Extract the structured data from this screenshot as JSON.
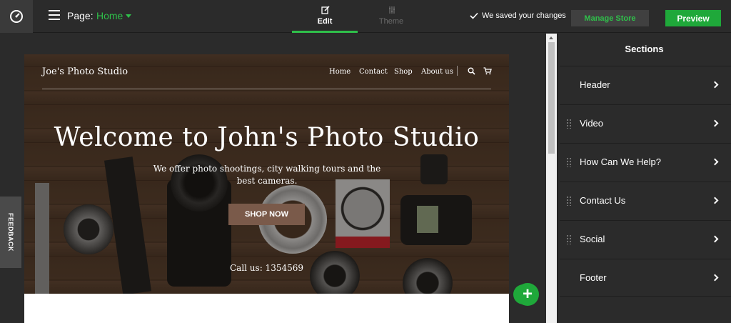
{
  "topbar": {
    "page_label": "Page:",
    "page_value": "Home",
    "tabs": [
      {
        "label": "Edit",
        "active": true
      },
      {
        "label": "Theme",
        "active": false
      }
    ],
    "saved_status": "We saved your changes",
    "manage_store_label": "Manage Store",
    "preview_label": "Preview"
  },
  "site": {
    "logo": "Joe's Photo Studio",
    "nav": [
      "Home",
      "Contact",
      "Shop",
      "About us"
    ],
    "hero_title": "Welcome to John's Photo Studio",
    "hero_subtitle": "We offer photo shootings, city walking tours and the best cameras.",
    "cta_label": "SHOP NOW",
    "call_text": "Call us: 1354569"
  },
  "feedback_label": "FEEDBACK",
  "sidebar": {
    "title": "Sections",
    "sections": [
      {
        "label": "Header",
        "draggable": false
      },
      {
        "label": "Video",
        "draggable": true
      },
      {
        "label": "How Can We Help?",
        "draggable": true
      },
      {
        "label": "Contact Us",
        "draggable": true
      },
      {
        "label": "Social",
        "draggable": true
      },
      {
        "label": "Footer",
        "draggable": false
      }
    ]
  },
  "colors": {
    "accent": "#2fbf4a",
    "preview": "#1fa83a",
    "bar_bg": "#2b2b2b",
    "cta_bg": "#7a5a4a"
  },
  "icons": [
    "dashboard-icon",
    "hamburger-menu-icon",
    "caret-down-icon",
    "edit-icon",
    "theme-icon",
    "checkmark-icon",
    "search-icon",
    "cart-icon",
    "plus-icon",
    "chevron-right-icon",
    "drag-handle-icon"
  ]
}
